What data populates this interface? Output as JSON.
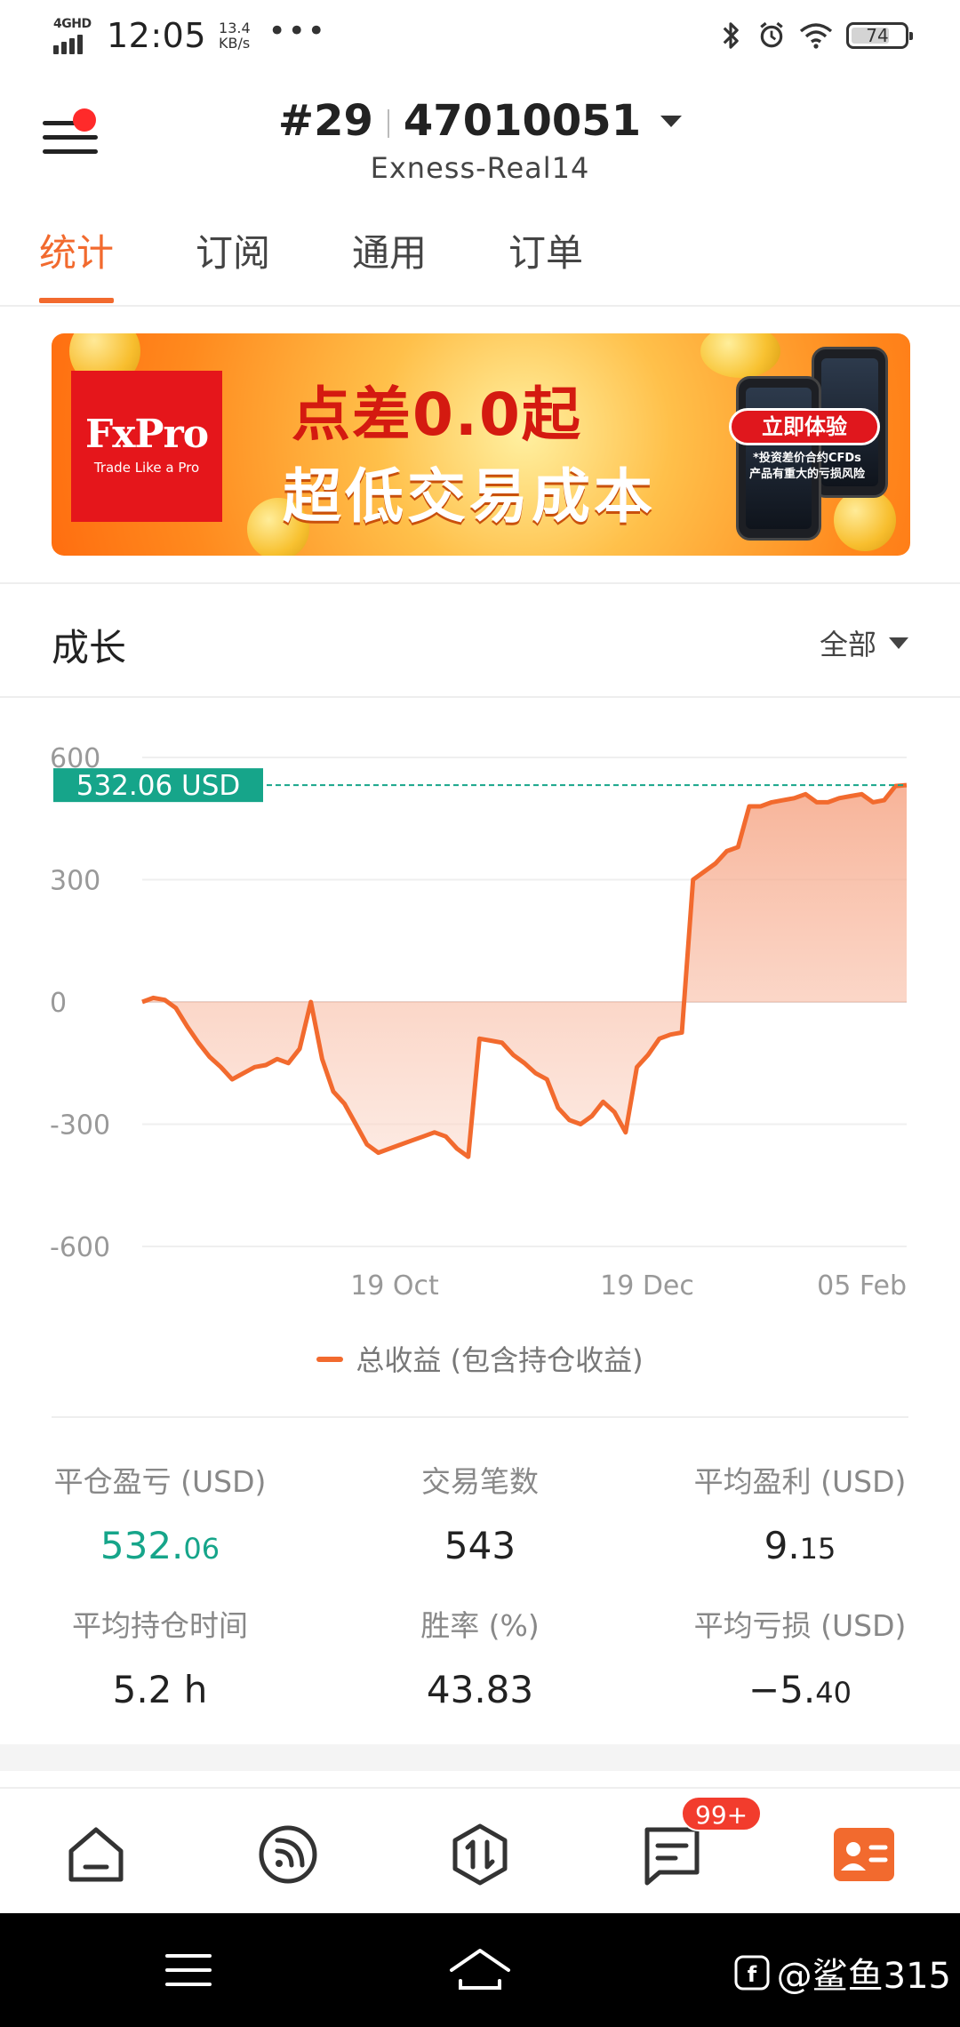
{
  "status_bar": {
    "network": "4GHD",
    "time": "12:05",
    "speed_value": "13.4",
    "speed_unit": "KB/s",
    "more": "•••",
    "battery": "74"
  },
  "header": {
    "rank": "#29",
    "account_number": "47010051",
    "server": "Exness-Real14"
  },
  "tabs": [
    {
      "label": "统计",
      "active": true
    },
    {
      "label": "订阅",
      "active": false
    },
    {
      "label": "通用",
      "active": false
    },
    {
      "label": "订单",
      "active": false
    }
  ],
  "banner": {
    "brand": "FxPro",
    "brand_tagline": "Trade Like a Pro",
    "headline": "点差0.0起",
    "subheadline": "超低交易成本",
    "cta": "立即体验",
    "risk_line1": "*投资差价合约CFDs",
    "risk_line2": "产品有重大的亏损风险"
  },
  "growth": {
    "title": "成长",
    "range": "全部"
  },
  "chart_data": {
    "type": "area",
    "current_value_label": "532.06 USD",
    "current_value": 532.06,
    "ylim": [
      -600,
      600
    ],
    "yticks": [
      "600",
      "300",
      "0",
      "-300",
      "-600"
    ],
    "xticks": [
      "19 Oct",
      "19 Dec",
      "05 Feb"
    ],
    "series": [
      {
        "name": "总收益 (包含持仓收益)",
        "color": "#f26a2e",
        "values": [
          0,
          10,
          5,
          -15,
          -60,
          -100,
          -135,
          -160,
          -190,
          -175,
          -160,
          -155,
          -140,
          -150,
          -115,
          0,
          -140,
          -220,
          -250,
          -300,
          -350,
          -370,
          -360,
          -350,
          -340,
          -330,
          -320,
          -330,
          -360,
          -380,
          -90,
          -95,
          -100,
          -130,
          -150,
          -175,
          -190,
          -260,
          -290,
          -300,
          -280,
          -245,
          -270,
          -320,
          -160,
          -130,
          -90,
          -80,
          -75,
          300,
          320,
          340,
          370,
          380,
          480,
          480,
          490,
          495,
          500,
          510,
          490,
          490,
          500,
          505,
          510,
          490,
          495,
          530,
          532.06
        ]
      }
    ]
  },
  "legend": {
    "label": "总收益 (包含持仓收益)"
  },
  "stats": {
    "closed_pnl_label": "平仓盈亏 (USD)",
    "closed_pnl_int": "532.",
    "closed_pnl_dec": "06",
    "trades_label": "交易笔数",
    "trades_value": "543",
    "avg_profit_label": "平均盈利 (USD)",
    "avg_profit_int": "9.",
    "avg_profit_dec": "15",
    "avg_hold_label": "平均持仓时间",
    "avg_hold_value": "5.2 h",
    "win_rate_label": "胜率 (%)",
    "win_rate_value": "43.83",
    "avg_loss_label": "平均亏损 (USD)",
    "avg_loss_int": "−5.",
    "avg_loss_dec": "40"
  },
  "bottom_nav": {
    "items": [
      "home-icon",
      "feed-icon",
      "trade-icon",
      "message-icon",
      "profile-icon"
    ],
    "badge": "99+"
  },
  "watermark": {
    "text": "@鲨鱼315"
  },
  "colors": {
    "accent": "#f26a2e",
    "green": "#16a58a",
    "badge": "#f23c2d"
  }
}
